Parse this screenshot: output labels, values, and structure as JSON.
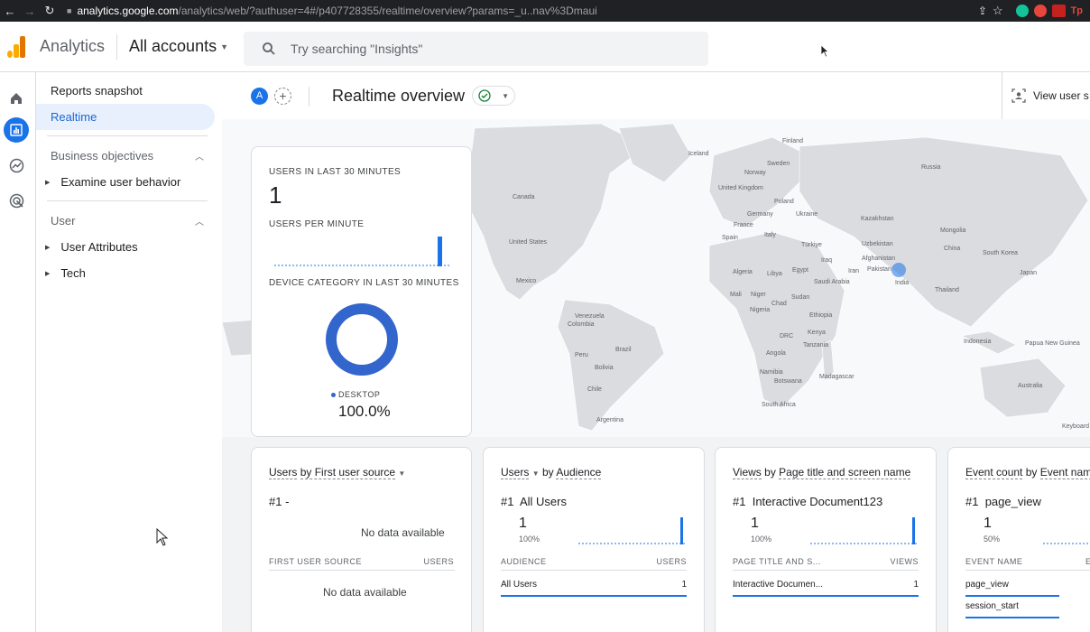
{
  "browser": {
    "url_host": "analytics.google.com",
    "url_path": "/analytics/web/?authuser=4#/p407728355/realtime/overview?params=_u..nav%3Dmaui"
  },
  "header": {
    "app_name": "Analytics",
    "account_selector": "All accounts",
    "search_placeholder": "Try searching \"Insights\""
  },
  "sidebar": {
    "reports_snapshot": "Reports snapshot",
    "realtime": "Realtime",
    "section_business": "Business objectives",
    "examine_user_behavior": "Examine user behavior",
    "section_user": "User",
    "user_attributes": "User Attributes",
    "tech": "Tech"
  },
  "toolbar": {
    "avatar_letter": "A",
    "page_title": "Realtime overview",
    "view_user_snapshot": "View user s"
  },
  "map": {
    "labels": [
      "Finland",
      "Iceland",
      "Sweden",
      "Norway",
      "Russia",
      "United Kingdom",
      "Poland",
      "Germany",
      "Ukraine",
      "France",
      "Kazakhstan",
      "Spain",
      "Italy",
      "Mongolia",
      "Türkiye",
      "Uzbekistan",
      "China",
      "South Korea",
      "Iraq",
      "Afghanistan",
      "Iran",
      "Pakistan",
      "Japan",
      "Algeria",
      "Libya",
      "Egypt",
      "Saudi Arabia",
      "India",
      "Thailand",
      "Mali",
      "Niger",
      "Sudan",
      "Chad",
      "Nigeria",
      "Ethiopia",
      "DRC",
      "Kenya",
      "Tanzania",
      "Angola",
      "Namibia",
      "Madagascar",
      "Botswana",
      "South Africa",
      "Indonesia",
      "Papua New Guinea",
      "Australia",
      "Canada",
      "United States",
      "Mexico",
      "Venezuela",
      "Colombia",
      "Peru",
      "Brazil",
      "Bolivia",
      "Chile",
      "Argentina",
      "Keyboard"
    ]
  },
  "kpi": {
    "users_30_label": "USERS IN LAST 30 MINUTES",
    "users_30_value": "1",
    "users_per_minute_label": "USERS PER MINUTE",
    "device_label": "DEVICE CATEGORY IN LAST 30 MINUTES",
    "device_legend": "DESKTOP",
    "device_pct": "100.0%"
  },
  "cards": {
    "first_source": {
      "title_a": "Users",
      "title_b": "by First user source",
      "rank": "#1 -",
      "no_data_top": "No data available",
      "col_left": "FIRST USER SOURCE",
      "col_right": "USERS",
      "no_data_bottom": "No data available"
    },
    "audience": {
      "title_a": "Users",
      "title_b": "by",
      "title_c": "Audience",
      "rank": "#1",
      "rank_label": "All Users",
      "value": "1",
      "pct": "100%",
      "col_left": "AUDIENCE",
      "col_right": "USERS",
      "rows": [
        {
          "name": "All Users",
          "value": "1"
        }
      ]
    },
    "page_title": {
      "title_a": "Views",
      "title_b": "by",
      "title_c": "Page title and screen name",
      "rank": "#1",
      "rank_label": "Interactive Document123",
      "value": "1",
      "pct": "100%",
      "col_left": "PAGE TITLE AND S...",
      "col_right": "VIEWS",
      "rows": [
        {
          "name": "Interactive Documen...",
          "value": "1"
        }
      ]
    },
    "event": {
      "title_a": "Event count",
      "title_b": "by",
      "title_c": "Event nam",
      "rank": "#1",
      "rank_label": "page_view",
      "value": "1",
      "pct": "50%",
      "col_left": "EVENT NAME",
      "col_right": "E",
      "rows": [
        {
          "name": "page_view"
        },
        {
          "name": "session_start"
        }
      ]
    }
  },
  "colors": {
    "accent": "#1a73e8",
    "active_bg": "#e8f0fe",
    "map_land": "#dadce0"
  }
}
